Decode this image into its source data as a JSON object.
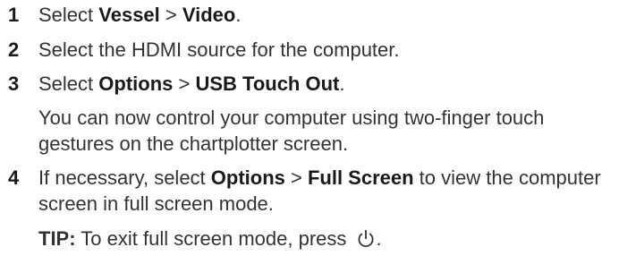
{
  "steps": [
    {
      "number": "1",
      "parts": {
        "pre": "Select ",
        "b1": "Vessel",
        "sep": " > ",
        "b2": "Video",
        "post": "."
      }
    },
    {
      "number": "2",
      "text": "Select the HDMI source for the computer."
    },
    {
      "number": "3",
      "parts": {
        "pre": "Select ",
        "b1": "Options",
        "sep": " > ",
        "b2": "USB Touch Out",
        "post": "."
      },
      "note": "You can now control your computer using two-finger touch gestures on the chartplotter screen."
    },
    {
      "number": "4",
      "parts": {
        "pre": "If necessary, select ",
        "b1": "Options",
        "sep": " > ",
        "b2": "Full Screen",
        "post": " to view the computer screen in full screen mode."
      },
      "tip": {
        "label": "TIP:",
        "text": " To exit full screen mode, press ",
        "icon": "power-icon",
        "end": "."
      }
    }
  ]
}
